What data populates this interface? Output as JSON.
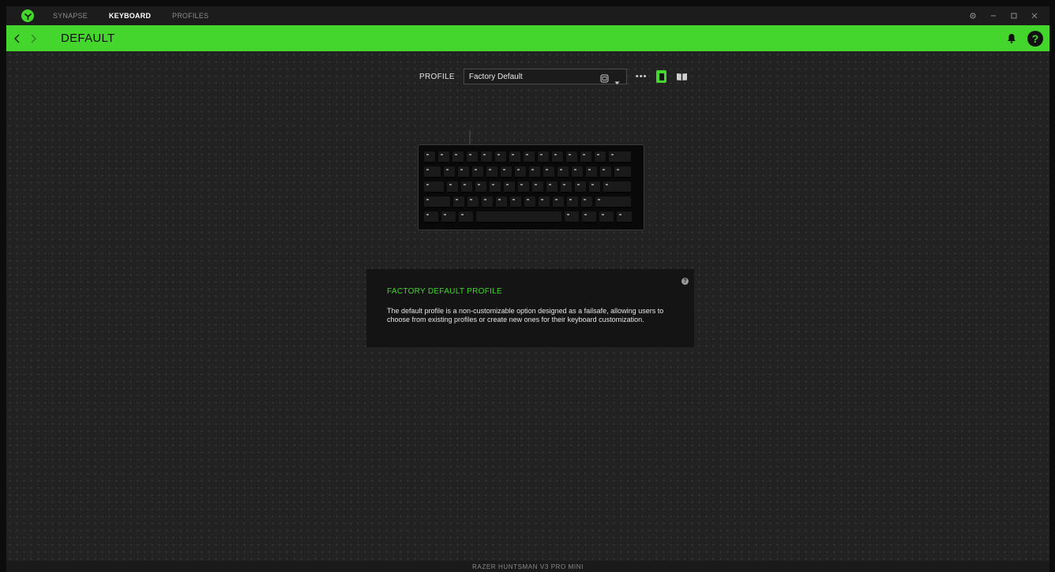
{
  "nav": {
    "tabs": [
      {
        "label": "SYNAPSE",
        "active": false
      },
      {
        "label": "KEYBOARD",
        "active": true
      },
      {
        "label": "PROFILES",
        "active": false
      }
    ]
  },
  "window_controls": {
    "icons": [
      "gear-icon",
      "minimize-icon",
      "maximize-icon",
      "close-icon"
    ]
  },
  "header": {
    "title": "DEFAULT",
    "icons": [
      "chevron-left-icon",
      "chevron-right-icon",
      "bell-icon",
      "help-icon"
    ],
    "help_label": "?"
  },
  "profile": {
    "label": "PROFILE",
    "selected": "Factory Default",
    "more_label": "•••"
  },
  "info_panel": {
    "title": "FACTORY DEFAULT PROFILE",
    "body": "The default profile is a non-customizable option designed as a failsafe, allowing users to choose from existing profiles or create new ones for their keyboard customization.",
    "help_label": "?"
  },
  "status_bar": {
    "device_name": "RAZER HUNTSMAN V3 PRO MINI"
  },
  "colors": {
    "accent": "#44d62c",
    "background": "#222222",
    "panel": "#141414"
  }
}
